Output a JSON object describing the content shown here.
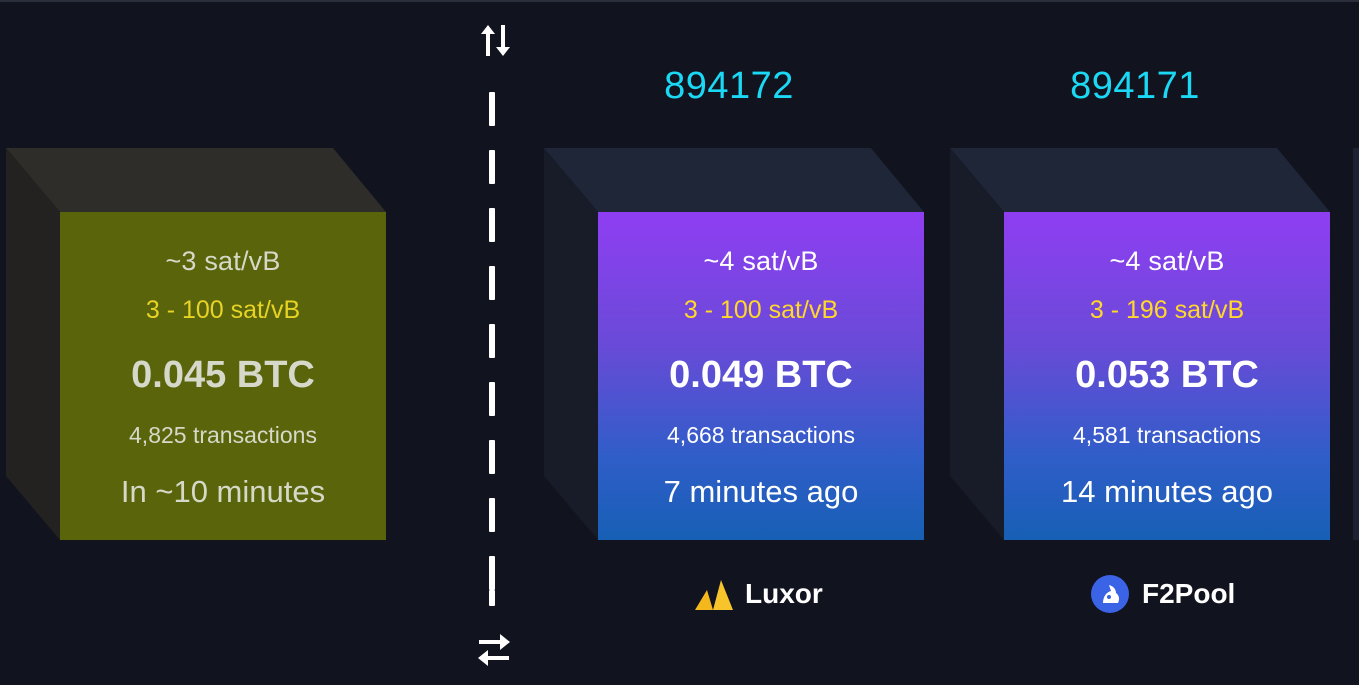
{
  "pending_block": {
    "fee": "~3 sat/vB",
    "fee_range": "3 - 100 sat/vB",
    "total": "0.045 BTC",
    "transactions": "4,825 transactions",
    "time": "In ~10 minutes"
  },
  "blocks": [
    {
      "height": "894172",
      "fee": "~4 sat/vB",
      "fee_range": "3 - 100 sat/vB",
      "total": "0.049 BTC",
      "transactions": "4,668 transactions",
      "time": "7 minutes ago",
      "pool": "Luxor",
      "pool_icon": "luxor-logo-icon"
    },
    {
      "height": "894171",
      "fee": "~4 sat/vB",
      "fee_range": "3 - 196 sat/vB",
      "total": "0.053 BTC",
      "transactions": "4,581 transactions",
      "time": "14 minutes ago",
      "pool": "F2Pool",
      "pool_icon": "f2pool-logo-icon"
    }
  ],
  "controls": {
    "top_icon": "swap-vertical-arrows-icon",
    "bottom_icon": "swap-horizontal-arrows-icon"
  },
  "colors": {
    "background": "#11131e",
    "height_text": "#1bd8f4",
    "fee_range_text": "#ffd82a",
    "pending_face": "#5a640a",
    "mined_gradient_top": "#8f3ef2",
    "mined_gradient_bottom": "#175fb5"
  }
}
